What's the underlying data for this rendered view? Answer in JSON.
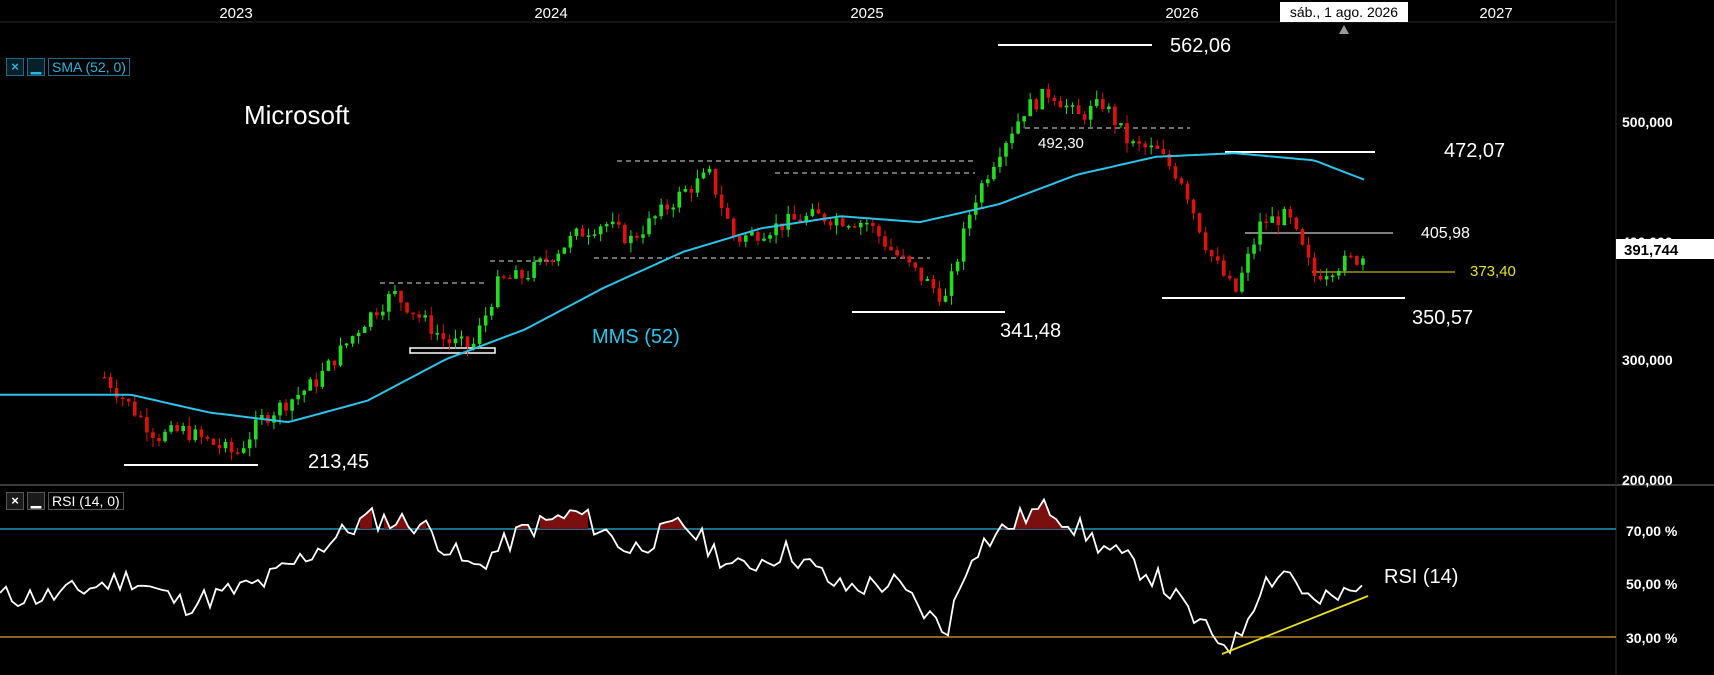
{
  "title": "Microsoft",
  "date_tooltip": "sáb., 1 ago. 2026",
  "years": [
    "2023",
    "2024",
    "2025",
    "2026",
    "2027"
  ],
  "price_axis": {
    "ticks": [
      "500,000",
      "400,000",
      "300,000",
      "200,000"
    ],
    "current": "391,744",
    "hidden_tick": "400,000"
  },
  "rsi_axis": {
    "ticks": [
      "70,00 %",
      "50,00 %",
      "30,00 %"
    ]
  },
  "indicators": {
    "sma_panel_label": "SMA (52, 0)",
    "rsi_panel_label": "RSI (14, 0)",
    "close_symbol": "×",
    "min_symbol": "▁"
  },
  "annotations": {
    "high": "562,06",
    "low_2025": "341,48",
    "low_2022": "213,45",
    "level_492": "492,30",
    "resist_472": "472,07",
    "level_405": "405,98",
    "support_yellow": "373,40",
    "low_2026": "350,57",
    "mms": "MMS (52)",
    "rsi": "RSI (14)"
  },
  "colors": {
    "background": "#000000",
    "up": "#22dd22",
    "down": "#dd1111",
    "sma": "#2bc4ea",
    "rsi_line": "#ffffff",
    "rsi_upper": "#2bb4e0",
    "rsi_lower": "#e0a030",
    "trendline": "#e8e020",
    "overbought_fill": "#7a0f0f"
  },
  "chart_data": {
    "type": "candlestick",
    "title": "Microsoft",
    "x_axis": "time (weekly)",
    "x_ticks": [
      "2023",
      "2024",
      "2025",
      "2026",
      "2027"
    ],
    "y_range": [
      200,
      600
    ],
    "price_path": [
      [
        "2022-08",
        290
      ],
      [
        "2022-10",
        240
      ],
      [
        "2022-11",
        245
      ],
      [
        "2023-01",
        225
      ],
      [
        "2023-02",
        255
      ],
      [
        "2023-04",
        285
      ],
      [
        "2023-06",
        340
      ],
      [
        "2023-07",
        360
      ],
      [
        "2023-09",
        320
      ],
      [
        "2023-10",
        315
      ],
      [
        "2023-11",
        370
      ],
      [
        "2023-12",
        375
      ],
      [
        "2024-02",
        410
      ],
      [
        "2024-03",
        420
      ],
      [
        "2024-04",
        405
      ],
      [
        "2024-06",
        445
      ],
      [
        "2024-07",
        460
      ],
      [
        "2024-08",
        405
      ],
      [
        "2024-10",
        420
      ],
      [
        "2024-11",
        425
      ],
      [
        "2025-01",
        420
      ],
      [
        "2025-02",
        395
      ],
      [
        "2025-04",
        355
      ],
      [
        "2025-05",
        435
      ],
      [
        "2025-06",
        480
      ],
      [
        "2025-07",
        515
      ],
      [
        "2025-08",
        530
      ],
      [
        "2025-09",
        508
      ],
      [
        "2025-10",
        520
      ],
      [
        "2025-11",
        485
      ],
      [
        "2025-12",
        480
      ],
      [
        "2026-01",
        455
      ],
      [
        "2026-02",
        395
      ],
      [
        "2026-03",
        360
      ],
      [
        "2026-04",
        420
      ],
      [
        "2026-05",
        425
      ],
      [
        "2026-06",
        375
      ],
      [
        "2026-07",
        385
      ],
      [
        "2026-08",
        392
      ]
    ],
    "sma52_path": [
      [
        "2022-06",
        275
      ],
      [
        "2022-09",
        275
      ],
      [
        "2022-12",
        260
      ],
      [
        "2023-03",
        252
      ],
      [
        "2023-06",
        270
      ],
      [
        "2023-09",
        305
      ],
      [
        "2023-12",
        330
      ],
      [
        "2024-03",
        365
      ],
      [
        "2024-06",
        395
      ],
      [
        "2024-09",
        415
      ],
      [
        "2024-12",
        425
      ],
      [
        "2025-03",
        420
      ],
      [
        "2025-06",
        435
      ],
      [
        "2025-09",
        460
      ],
      [
        "2025-12",
        475
      ],
      [
        "2026-03",
        478
      ],
      [
        "2026-06",
        472
      ],
      [
        "2026-08",
        455
      ]
    ],
    "rsi_path": [
      [
        "2022-06",
        45
      ],
      [
        "2022-09",
        52
      ],
      [
        "2022-11",
        42
      ],
      [
        "2023-02",
        50
      ],
      [
        "2023-04",
        62
      ],
      [
        "2023-06",
        74
      ],
      [
        "2023-08",
        72
      ],
      [
        "2023-10",
        55
      ],
      [
        "2023-12",
        70
      ],
      [
        "2024-02",
        76
      ],
      [
        "2024-04",
        62
      ],
      [
        "2024-06",
        72
      ],
      [
        "2024-08",
        55
      ],
      [
        "2024-10",
        62
      ],
      [
        "2024-12",
        48
      ],
      [
        "2025-02",
        50
      ],
      [
        "2025-04",
        32
      ],
      [
        "2025-05",
        62
      ],
      [
        "2025-07",
        75
      ],
      [
        "2025-08",
        78
      ],
      [
        "2025-10",
        63
      ],
      [
        "2025-12",
        52
      ],
      [
        "2026-02",
        31
      ],
      [
        "2026-03",
        27
      ],
      [
        "2026-04",
        50
      ],
      [
        "2026-05",
        55
      ],
      [
        "2026-06",
        42
      ],
      [
        "2026-08",
        48
      ]
    ],
    "rsi_levels": [
      70,
      30
    ],
    "levels": {
      "high": 562.06,
      "resist_472": 472.07,
      "level_492": 492.3,
      "level_405": 405.98,
      "support_373": 373.4,
      "low_350": 350.57,
      "low_341": 341.48,
      "low_213": 213.45,
      "current": 391.744
    }
  }
}
